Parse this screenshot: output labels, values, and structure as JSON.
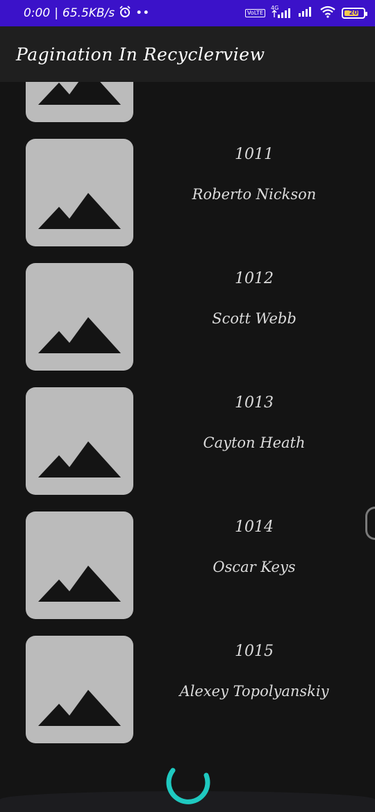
{
  "status_bar": {
    "time": "0:00",
    "separator": "|",
    "speed": "65.5KB/s",
    "alarm_icon": "alarm-icon",
    "dots": "••",
    "volte": "VoLTE",
    "network": "4G",
    "battery": "20",
    "colors": {
      "background": "#3b12c9",
      "battery_fill": "#f2c94c"
    }
  },
  "app_bar": {
    "title": "Pagination In Recyclerview"
  },
  "list": {
    "items": [
      {
        "id": "",
        "name": ""
      },
      {
        "id": "1011",
        "name": "Roberto Nickson"
      },
      {
        "id": "1012",
        "name": "Scott Webb"
      },
      {
        "id": "1013",
        "name": "Cayton Heath"
      },
      {
        "id": "1014",
        "name": "Oscar Keys"
      },
      {
        "id": "1015",
        "name": "Alexey Topolyanskiy"
      }
    ],
    "thumbnail_icon": "image-placeholder-icon"
  },
  "loader": {
    "icon": "progress-spinner-icon",
    "color": "#1fc9c0"
  }
}
